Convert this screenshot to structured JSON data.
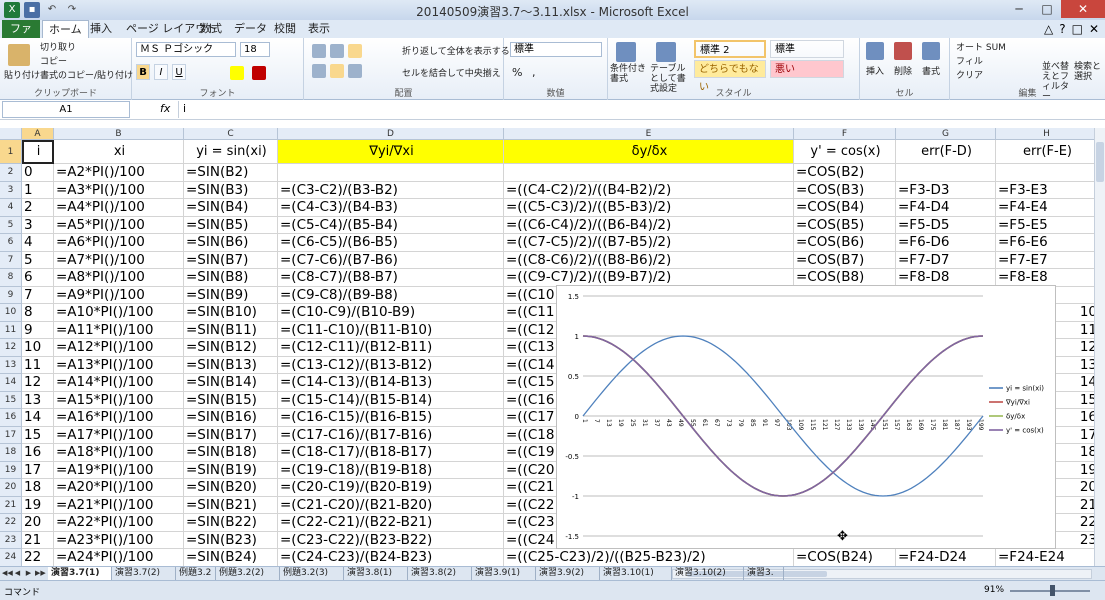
{
  "window": {
    "title": "20140509演習3.7～3.11.xlsx - Microsoft Excel",
    "controls": [
      "─",
      "□",
      "✕"
    ]
  },
  "ribbon": {
    "tabs": [
      "ファイル",
      "ホーム",
      "挿入",
      "ページ レイアウト",
      "数式",
      "データ",
      "校閲",
      "表示"
    ],
    "active_tab": "ホーム",
    "clipboard": {
      "paste": "貼り付け",
      "cut": "切り取り",
      "copy": "コピー",
      "format_painter": "書式のコピー/貼り付け",
      "label": "クリップボード"
    },
    "font": {
      "name": "ＭＳ Ｐゴシック",
      "size": "18",
      "bold": "B",
      "italic": "I",
      "underline": "U",
      "label": "フォント"
    },
    "alignment": {
      "wrap": "折り返して全体を表示する",
      "merge": "セルを結合して中央揃え",
      "label": "配置"
    },
    "number": {
      "format": "標準",
      "label": "数値"
    },
    "styles": {
      "conditional": "条件付き書式",
      "table": "テーブルとして書式設定",
      "style2": "標準 2",
      "standard": "標準",
      "neutral": "どちらでもない",
      "bad": "悪い",
      "label": "スタイル"
    },
    "cells": {
      "insert": "挿入",
      "delete": "削除",
      "format": "書式",
      "label": "セル"
    },
    "editing": {
      "autosum": "オート SUM",
      "fill": "フィル",
      "clear": "クリア",
      "sort": "並べ替えとフィルター",
      "find": "検索と選択",
      "label": "編集"
    }
  },
  "formula_bar": {
    "name_box": "A1",
    "fx": "fx",
    "value": "i"
  },
  "grid": {
    "columns": [
      "A",
      "B",
      "C",
      "D",
      "E",
      "F",
      "G",
      "H"
    ],
    "header_row": [
      "i",
      "xi",
      "yi = sin(xi)",
      "∇yi/∇xi",
      "δy/δx",
      "y' = cos(x)",
      "err(F-D)",
      "err(F-E)"
    ],
    "rows": [
      [
        "0",
        "=A2*PI()/100",
        "=SIN(B2)",
        "",
        "",
        "=COS(B2)",
        "",
        ""
      ],
      [
        "1",
        "=A3*PI()/100",
        "=SIN(B3)",
        "=(C3-C2)/(B3-B2)",
        "=((C4-C2)/2)/((B4-B2)/2)",
        "=COS(B3)",
        "=F3-D3",
        "=F3-E3"
      ],
      [
        "2",
        "=A4*PI()/100",
        "=SIN(B4)",
        "=(C4-C3)/(B4-B3)",
        "=((C5-C3)/2)/((B5-B3)/2)",
        "=COS(B4)",
        "=F4-D4",
        "=F4-E4"
      ],
      [
        "3",
        "=A5*PI()/100",
        "=SIN(B5)",
        "=(C5-C4)/(B5-B4)",
        "=((C6-C4)/2)/((B6-B4)/2)",
        "=COS(B5)",
        "=F5-D5",
        "=F5-E5"
      ],
      [
        "4",
        "=A6*PI()/100",
        "=SIN(B6)",
        "=(C6-C5)/(B6-B5)",
        "=((C7-C5)/2)/((B7-B5)/2)",
        "=COS(B6)",
        "=F6-D6",
        "=F6-E6"
      ],
      [
        "5",
        "=A7*PI()/100",
        "=SIN(B7)",
        "=(C7-C6)/(B7-B6)",
        "=((C8-C6)/2)/((B8-B6)/2)",
        "=COS(B7)",
        "=F7-D7",
        "=F7-E7"
      ],
      [
        "6",
        "=A8*PI()/100",
        "=SIN(B8)",
        "=(C8-C7)/(B8-B7)",
        "=((C9-C7)/2)/((B9-B7)/2)",
        "=COS(B8)",
        "=F8-D8",
        "=F8-E8"
      ],
      [
        "7",
        "=A9*PI()/100",
        "=SIN(B9)",
        "=(C9-C8)/(B9-B8)",
        "=((C10",
        "",
        "",
        ""
      ],
      [
        "8",
        "=A10*PI()/100",
        "=SIN(B10)",
        "=(C10-C9)/(B10-B9)",
        "=((C11",
        "",
        "",
        "10"
      ],
      [
        "9",
        "=A11*PI()/100",
        "=SIN(B11)",
        "=(C11-C10)/(B11-B10)",
        "=((C12",
        "",
        "",
        "11"
      ],
      [
        "10",
        "=A12*PI()/100",
        "=SIN(B12)",
        "=(C12-C11)/(B12-B11)",
        "=((C13",
        "",
        "",
        "12"
      ],
      [
        "11",
        "=A13*PI()/100",
        "=SIN(B13)",
        "=(C13-C12)/(B13-B12)",
        "=((C14",
        "",
        "",
        "13"
      ],
      [
        "12",
        "=A14*PI()/100",
        "=SIN(B14)",
        "=(C14-C13)/(B14-B13)",
        "=((C15",
        "",
        "",
        "14"
      ],
      [
        "13",
        "=A15*PI()/100",
        "=SIN(B15)",
        "=(C15-C14)/(B15-B14)",
        "=((C16",
        "",
        "",
        "15"
      ],
      [
        "14",
        "=A16*PI()/100",
        "=SIN(B16)",
        "=(C16-C15)/(B16-B15)",
        "=((C17",
        "",
        "",
        "16"
      ],
      [
        "15",
        "=A17*PI()/100",
        "=SIN(B17)",
        "=(C17-C16)/(B17-B16)",
        "=((C18",
        "",
        "",
        "17"
      ],
      [
        "16",
        "=A18*PI()/100",
        "=SIN(B18)",
        "=(C18-C17)/(B18-B17)",
        "=((C19",
        "",
        "",
        "18"
      ],
      [
        "17",
        "=A19*PI()/100",
        "=SIN(B19)",
        "=(C19-C18)/(B19-B18)",
        "=((C20",
        "",
        "",
        "19"
      ],
      [
        "18",
        "=A20*PI()/100",
        "=SIN(B20)",
        "=(C20-C19)/(B20-B19)",
        "=((C21",
        "",
        "",
        "20"
      ],
      [
        "19",
        "=A21*PI()/100",
        "=SIN(B21)",
        "=(C21-C20)/(B21-B20)",
        "=((C22",
        "",
        "",
        "21"
      ],
      [
        "20",
        "=A22*PI()/100",
        "=SIN(B22)",
        "=(C22-C21)/(B22-B21)",
        "=((C23",
        "",
        "",
        "22"
      ],
      [
        "21",
        "=A23*PI()/100",
        "=SIN(B23)",
        "=(C23-C22)/(B23-B22)",
        "=((C24",
        "",
        "",
        "23"
      ],
      [
        "22",
        "=A24*PI()/100",
        "=SIN(B24)",
        "=(C24-C23)/(B24-B23)",
        "=((C25-C23)/2)/((B25-B23)/2)",
        "=COS(B24)",
        "=F24-D24",
        "=F24-E24"
      ]
    ]
  },
  "chart_data": {
    "type": "line",
    "ylim": [
      -1.5,
      1.5
    ],
    "y_ticks": [
      "1.5",
      "1",
      "0.5",
      "0",
      "-0.5",
      "-1",
      "-1.5"
    ],
    "x_ticks": [
      "1",
      "7",
      "13",
      "19",
      "25",
      "31",
      "37",
      "43",
      "49",
      "55",
      "61",
      "67",
      "73",
      "79",
      "85",
      "91",
      "97",
      "103",
      "109",
      "115",
      "121",
      "127",
      "133",
      "139",
      "145",
      "151",
      "157",
      "163",
      "169",
      "175",
      "181",
      "187",
      "193",
      "199"
    ],
    "x_range": [
      1,
      201
    ],
    "series": [
      {
        "name": "yi = sin(xi)",
        "color": "#4f81bd",
        "function": "sin",
        "period_points": 200
      },
      {
        "name": "∇yi/∇xi",
        "color": "#c0504d",
        "function": "cos",
        "period_points": 200
      },
      {
        "name": "δy/δx",
        "color": "#9bbb59",
        "function": "cos",
        "period_points": 200
      },
      {
        "name": "y' = cos(x)",
        "color": "#8064a2",
        "function": "cos",
        "period_points": 200
      }
    ]
  },
  "sheet_tabs": [
    "演習3.7(1)",
    "演習3.7(2)",
    "例題3.2",
    "例題3.2(2)",
    "例題3.2(3)",
    "演習3.8(1)",
    "演習3.8(2)",
    "演習3.9(1)",
    "演習3.9(2)",
    "演習3.10(1)",
    "演習3.10(2)",
    "演習3."
  ],
  "active_sheet": "演習3.7(1)",
  "status": {
    "mode": "コマンド",
    "zoom": "91%"
  }
}
